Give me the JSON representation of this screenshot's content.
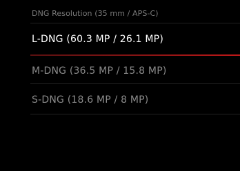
{
  "menu": {
    "title": "DNG Resolution (35 mm / APS-C)",
    "accent_color": "#c01818",
    "options": [
      {
        "label": "L-DNG (60.3 MP / 26.1 MP)",
        "selected": true
      },
      {
        "label": "M-DNG (36.5 MP / 15.8 MP)",
        "selected": false
      },
      {
        "label": "S-DNG (18.6 MP / 8 MP)",
        "selected": false
      }
    ]
  }
}
